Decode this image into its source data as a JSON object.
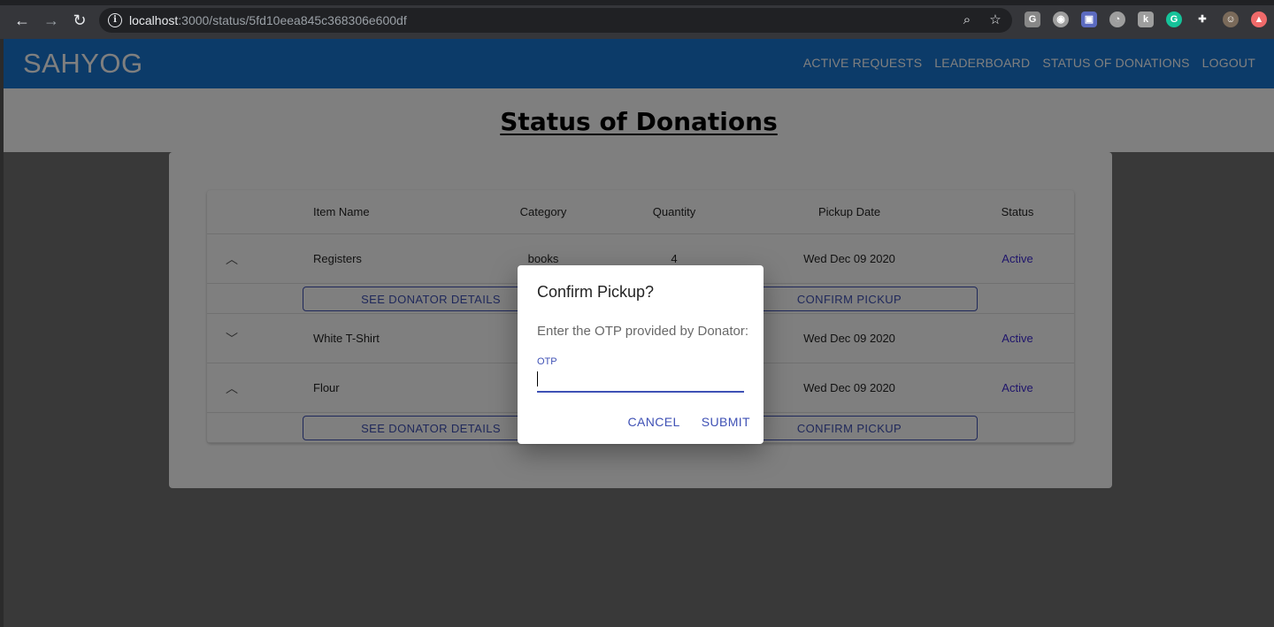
{
  "browser": {
    "url_host": "localhost",
    "url_path": ":3000/status/5fd10eea845c368306e600df",
    "extensions": [
      {
        "name": "grammarly-g-icon",
        "glyph": "G",
        "color": "#888888"
      },
      {
        "name": "circle-extension-icon",
        "glyph": "◉",
        "color": "#9e9e9e"
      },
      {
        "name": "camera-extension-icon",
        "glyph": "▣",
        "color": "#5c6bc0"
      },
      {
        "name": "clock-extension-icon",
        "glyph": "◔",
        "color": "#9e9e9e"
      },
      {
        "name": "k-extension-icon",
        "glyph": "k",
        "color": "#9e9e9e"
      },
      {
        "name": "grammarly-icon",
        "glyph": "G",
        "color": "#15c39a"
      },
      {
        "name": "puzzle-icon",
        "glyph": "✚",
        "color": "#35363a"
      },
      {
        "name": "profile-avatar-icon",
        "glyph": "☺",
        "color": "#7a6a5a"
      },
      {
        "name": "red-extension-icon",
        "glyph": "▲",
        "color": "#f06a6a"
      }
    ]
  },
  "appbar": {
    "logo": "SAHYOG",
    "links": [
      "ACTIVE REQUESTS",
      "LEADERBOARD",
      "STATUS OF DONATIONS",
      "LOGOUT"
    ]
  },
  "page": {
    "title": "Status of Donations"
  },
  "table": {
    "headers": {
      "item": "Item Name",
      "category": "Category",
      "quantity": "Quantity",
      "date": "Pickup Date",
      "status": "Status"
    },
    "rows": [
      {
        "item": "Registers",
        "category": "books",
        "quantity": "4",
        "date": "Wed Dec 09 2020",
        "status": "Active",
        "expanded": true
      },
      {
        "item": "White T-Shirt",
        "category": "",
        "quantity": "",
        "date": "Wed Dec 09 2020",
        "status": "Active",
        "expanded": false
      },
      {
        "item": "Flour",
        "category": "",
        "quantity": "",
        "date": "Wed Dec 09 2020",
        "status": "Active",
        "expanded": true
      }
    ],
    "see_details_label": "SEE DONATOR DETAILS",
    "confirm_pickup_label": "CONFIRM PICKUP"
  },
  "dialog": {
    "title": "Confirm Pickup?",
    "text": "Enter the OTP provided by Donator:",
    "otp_label": "OTP",
    "otp_value": "",
    "cancel": "CANCEL",
    "submit": "SUBMIT"
  },
  "colors": {
    "appbar": "#1976d2",
    "primary": "#3f51b5",
    "status_active": "#3f2bd6"
  }
}
